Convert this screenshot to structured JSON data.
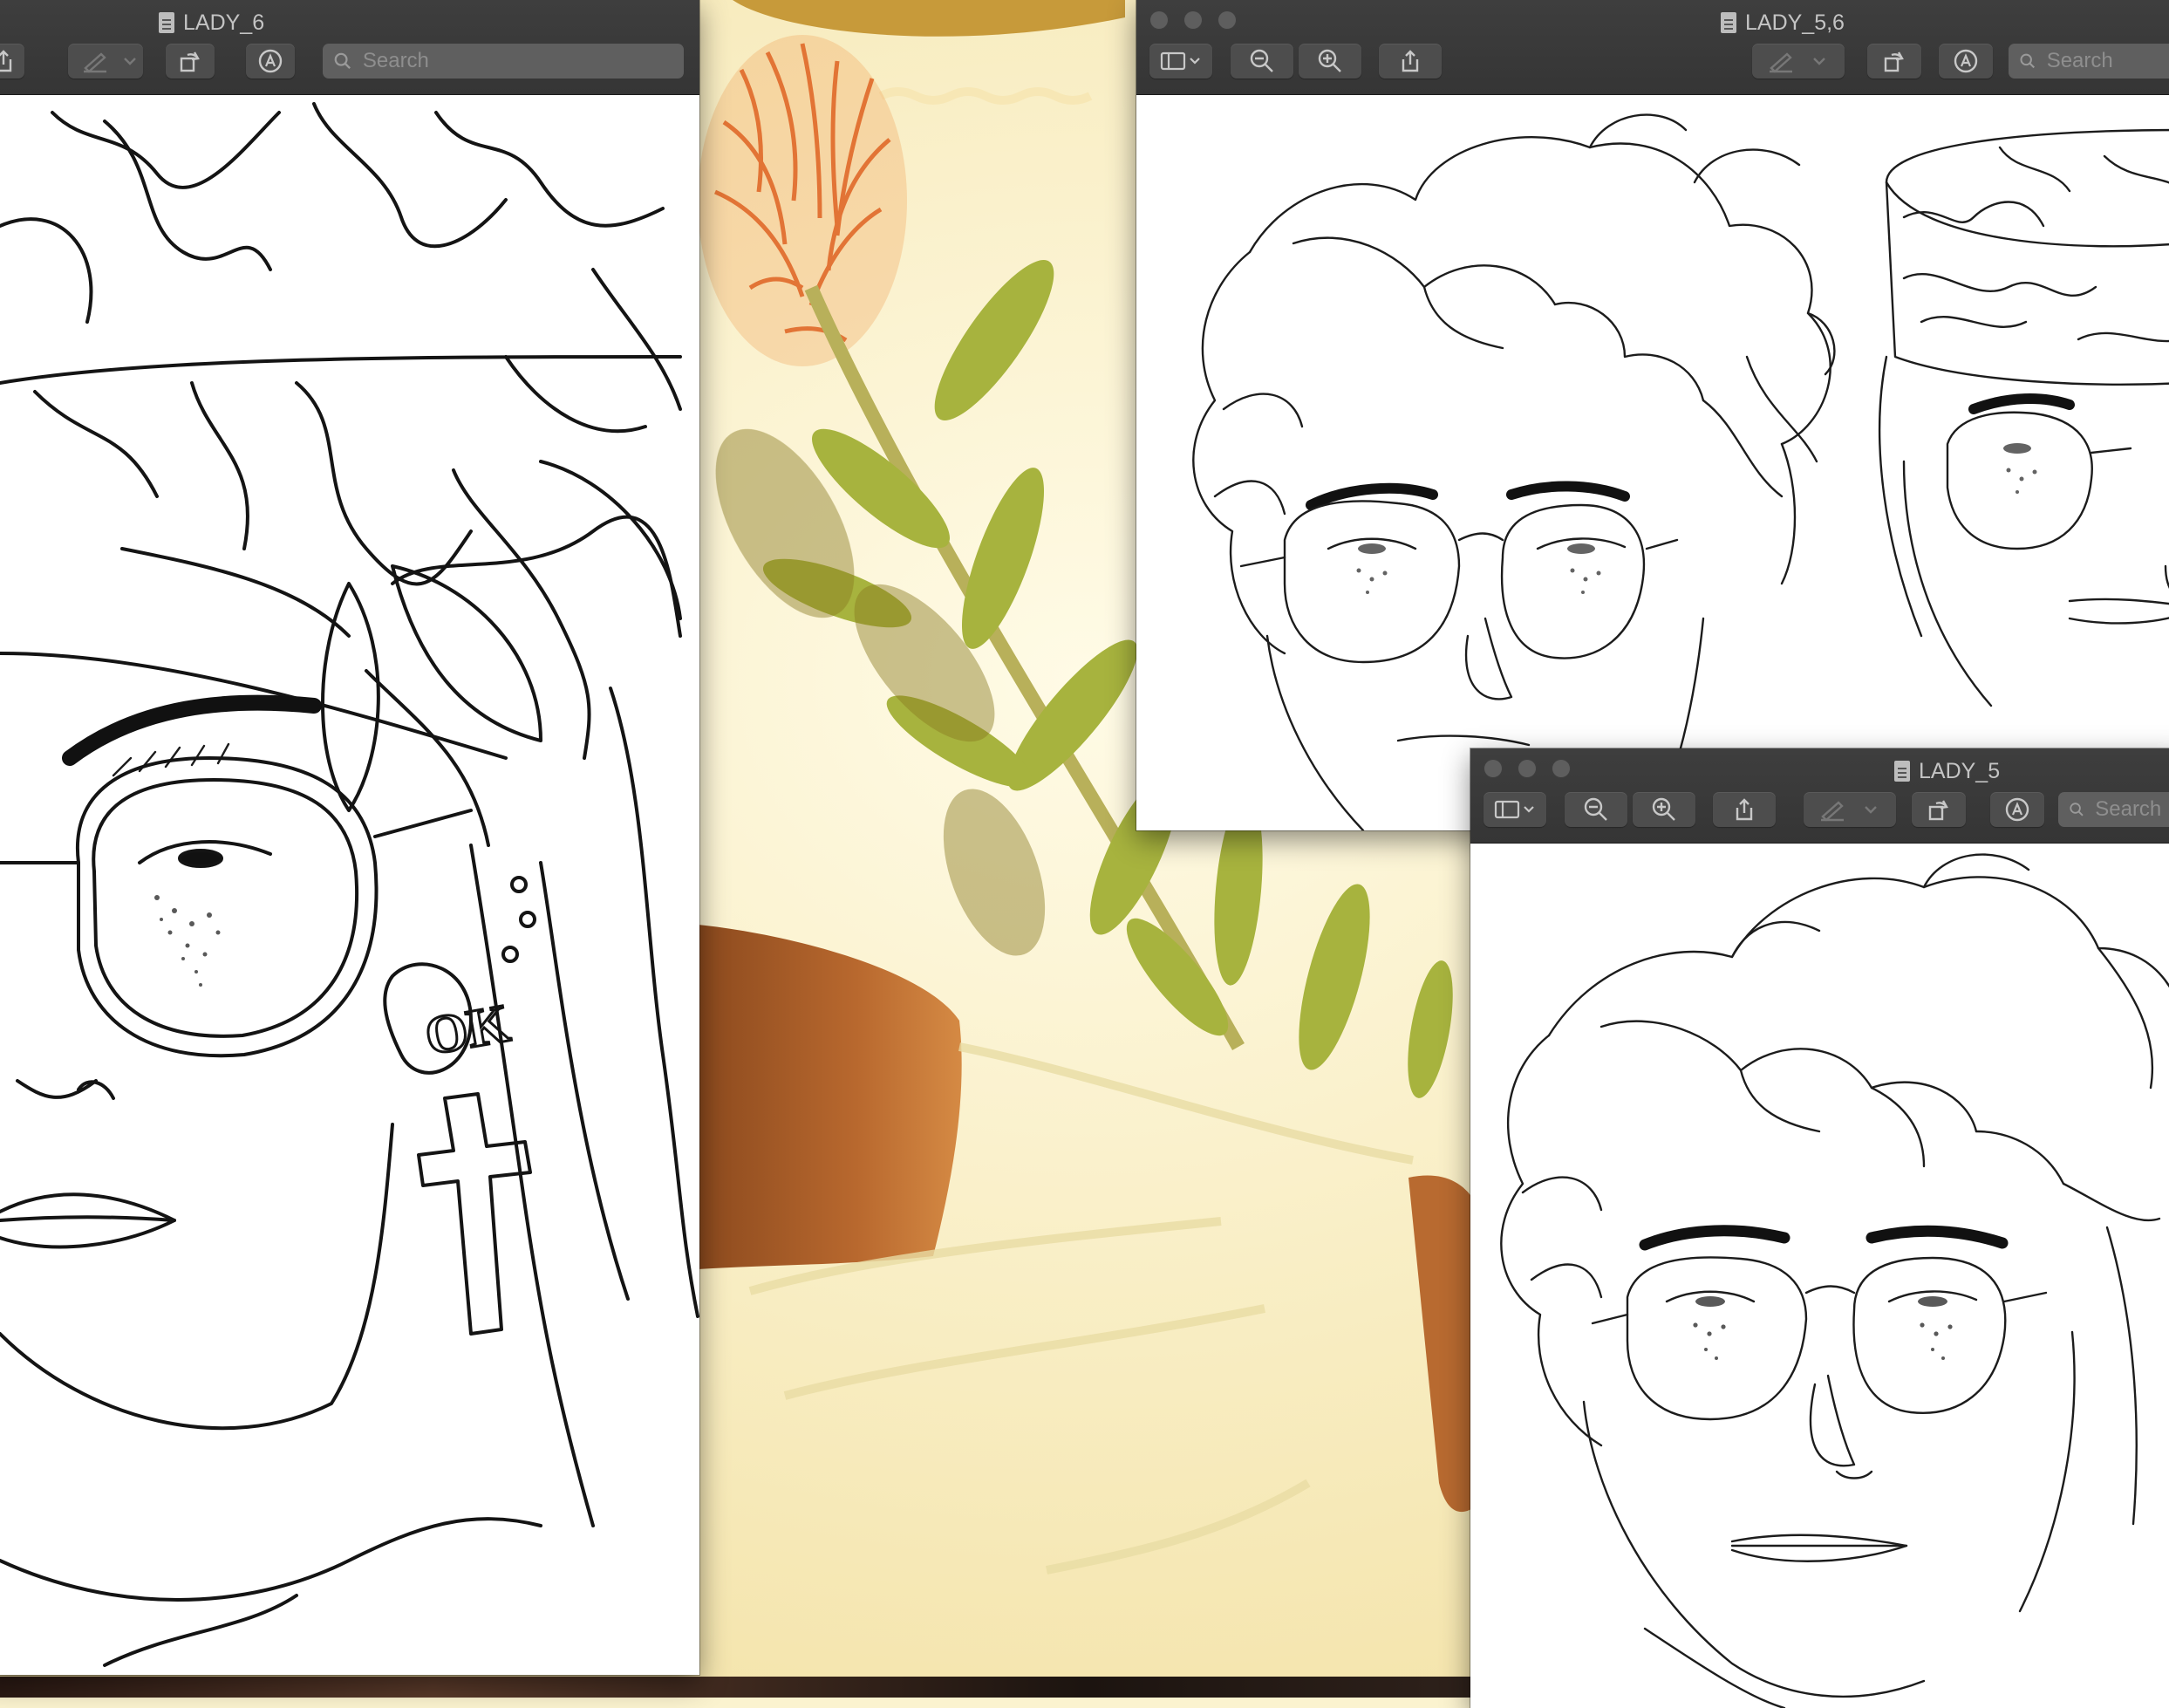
{
  "windows": {
    "lady6": {
      "title": "LADY_6",
      "search": {
        "placeholder": "Search",
        "value": ""
      }
    },
    "lady56": {
      "title": "LADY_5,6",
      "search": {
        "placeholder": "Search",
        "value": ""
      }
    },
    "lady5": {
      "title": "LADY_5",
      "search": {
        "placeholder": "Search",
        "value": ""
      }
    }
  },
  "drawing_text": {
    "earring_letters": "OK"
  },
  "icons": {
    "document": "document-icon",
    "sidebar": "sidebar-toggle-icon",
    "zoom_out": "zoom-out-icon",
    "zoom_in": "zoom-in-icon",
    "share": "share-icon",
    "markup_pen": "markup-pen-icon",
    "rotate": "rotate-icon",
    "annotate": "annotate-icon",
    "search": "search-icon"
  },
  "colors": {
    "titlebar": "#3a3a3a",
    "toolbar_button": "#4d4d4d",
    "title_text": "#c4c4c4",
    "desktop_photo_base": "#fbf3cf",
    "skin": "#b8682e",
    "leaf": "#9aa83a",
    "flower": "#e06a2a"
  }
}
